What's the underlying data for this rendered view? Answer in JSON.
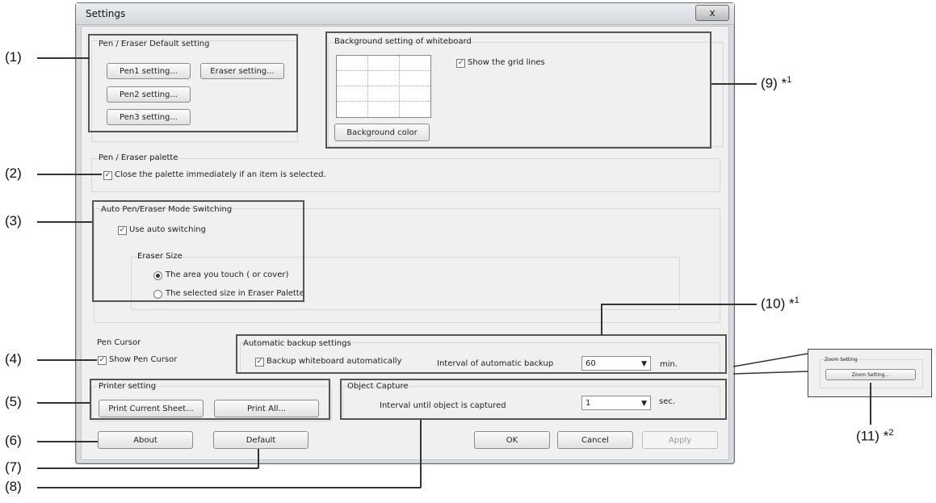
{
  "window": {
    "title": "Settings",
    "close_symbol": "x"
  },
  "pen_eraser_default": {
    "title": "Pen / Eraser Default setting",
    "pen1": "Pen1 setting...",
    "eraser": "Eraser setting...",
    "pen2": "Pen2 setting...",
    "pen3": "Pen3 setting..."
  },
  "background": {
    "title": "Background setting of whiteboard",
    "show_grid": "Show the grid lines",
    "color_button": "Background color"
  },
  "palette": {
    "title": "Pen / Eraser palette",
    "close_palette": "Close the palette immediately if an item is selected."
  },
  "auto_switch": {
    "title": "Auto Pen/Eraser Mode Switching",
    "use_auto": "Use auto switching",
    "eraser_size_title": "Eraser Size",
    "option_touch": "The area you touch ( or cover)",
    "option_palette": "The selected size in Eraser Palette"
  },
  "pen_cursor": {
    "title": "Pen Cursor",
    "show": "Show Pen Cursor"
  },
  "backup": {
    "title": "Automatic backup settings",
    "backup_auto": "Backup whiteboard automatically",
    "interval_label": "Interval of automatic backup",
    "interval_value": "60",
    "unit": "min."
  },
  "printer": {
    "title": "Printer setting",
    "print_current": "Print Current Sheet...",
    "print_all": "Print All..."
  },
  "object_capture": {
    "title": "Object Capture",
    "interval_label": "Interval until object is captured",
    "value": "1",
    "unit": "sec."
  },
  "footer": {
    "about": "About",
    "default": "Default",
    "ok": "OK",
    "cancel": "Cancel",
    "apply": "Apply"
  },
  "zoom_inset": {
    "title": "Zoom Setting",
    "button": "Zoom Setting..."
  },
  "callouts": {
    "c1": "(1)",
    "c2": "(2)",
    "c3": "(3)",
    "c4": "(4)",
    "c5": "(5)",
    "c6": "(6)",
    "c7": "(7)",
    "c8": "(8)",
    "c9": "(9)",
    "c10": "(10)",
    "c11": "(11)",
    "note1": "*",
    "sup1": "1",
    "note2": "*",
    "sup2": "2"
  }
}
